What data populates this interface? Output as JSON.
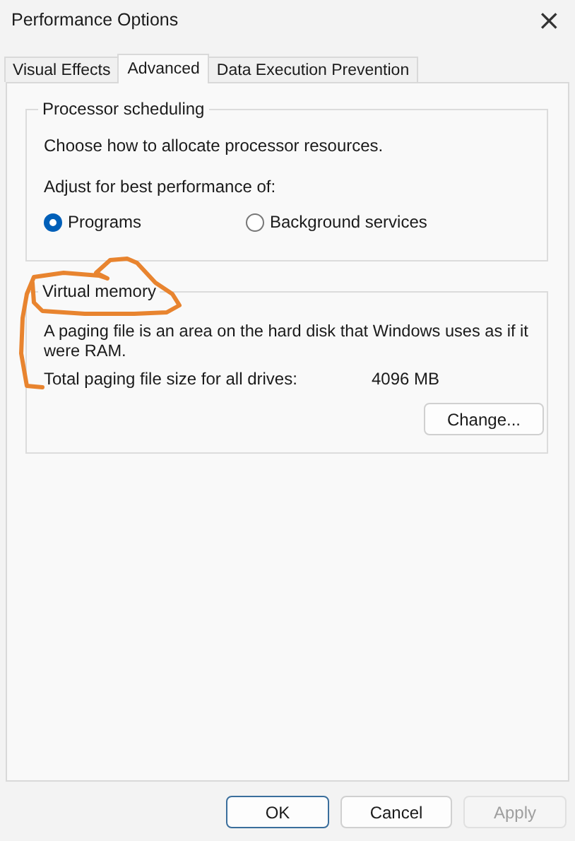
{
  "window": {
    "title": "Performance Options",
    "close": "×"
  },
  "tabs": [
    {
      "label": "Visual Effects",
      "selected": false
    },
    {
      "label": "Advanced",
      "selected": true
    },
    {
      "label": "Data Execution Prevention",
      "selected": false
    }
  ],
  "processor_scheduling": {
    "title": "Processor scheduling",
    "description": "Choose how to allocate processor resources.",
    "prompt": "Adjust for best performance of:",
    "options": [
      {
        "label": "Programs",
        "selected": true
      },
      {
        "label": "Background services",
        "selected": false
      }
    ]
  },
  "virtual_memory": {
    "title": "Virtual memory",
    "description": "A paging file is an area on the hard disk that Windows uses as if it were RAM.",
    "size_label": "Total paging file size for all drives:",
    "size_value": "4096 MB",
    "button": "Change..."
  },
  "buttons": [
    {
      "label": "OK",
      "default": true,
      "disabled": false
    },
    {
      "label": "Cancel",
      "default": false,
      "disabled": false
    },
    {
      "label": "Apply",
      "default": false,
      "disabled": true
    }
  ]
}
